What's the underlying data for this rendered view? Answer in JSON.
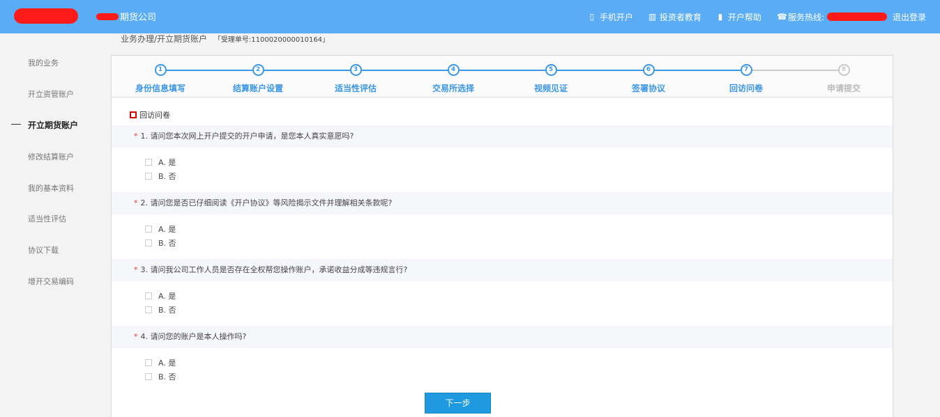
{
  "header": {
    "company_suffix": "期货公司",
    "nav": [
      {
        "icon": "mobile-icon",
        "glyph": "▯",
        "label": "手机开户"
      },
      {
        "icon": "books-icon",
        "glyph": "▥",
        "label": "投资者教育"
      },
      {
        "icon": "bookmark-icon",
        "glyph": "▮",
        "label": "开户帮助"
      },
      {
        "icon": "phone-icon",
        "glyph": "☎",
        "label": "服务热线:"
      }
    ],
    "logout": "退出登录",
    "accent_color": "#5aadf5"
  },
  "breadcrumb": {
    "path": "业务办理/开立期货账户",
    "ticket": "「受理单号:1100020000010164」"
  },
  "sidebar": {
    "items": [
      {
        "label": "我的业务",
        "active": false
      },
      {
        "label": "开立资管账户",
        "active": false
      },
      {
        "label": "开立期货账户",
        "active": true
      },
      {
        "label": "修改结算账户",
        "active": false
      },
      {
        "label": "我的基本资料",
        "active": false
      },
      {
        "label": "适当性评估",
        "active": false
      },
      {
        "label": "协议下载",
        "active": false
      },
      {
        "label": "增开交易编码",
        "active": false
      }
    ]
  },
  "steps": [
    {
      "num": "1",
      "label": "身份信息填写",
      "done": true
    },
    {
      "num": "2",
      "label": "结算账户设置",
      "done": true
    },
    {
      "num": "3",
      "label": "适当性评估",
      "done": true
    },
    {
      "num": "4",
      "label": "交易所选择",
      "done": true
    },
    {
      "num": "5",
      "label": "视频见证",
      "done": true
    },
    {
      "num": "6",
      "label": "签署协议",
      "done": true
    },
    {
      "num": "7",
      "label": "回访问卷",
      "done": true
    },
    {
      "num": "8",
      "label": "申请提交",
      "done": false
    }
  ],
  "section_title": "回访问卷",
  "questions": [
    {
      "star": "*",
      "text": "1. 请问您本次网上开户提交的开户申请，是您本人真实意愿吗?",
      "options": [
        "A. 是",
        "B. 否"
      ]
    },
    {
      "star": "*",
      "text": "2. 请问您是否已仔细阅读《开户协议》等风险揭示文件并理解相关条款呢?",
      "options": [
        "A. 是",
        "B. 否"
      ]
    },
    {
      "star": "*",
      "text": "3. 请问我公司工作人员是否存在全权帮您操作账户，承诺收益分成等违规言行?",
      "options": [
        "A. 是",
        "B. 否"
      ]
    },
    {
      "star": "*",
      "text": "4. 请问您的账户是本人操作吗?",
      "options": [
        "A. 是",
        "B. 否"
      ]
    }
  ],
  "next_button": "下一步"
}
